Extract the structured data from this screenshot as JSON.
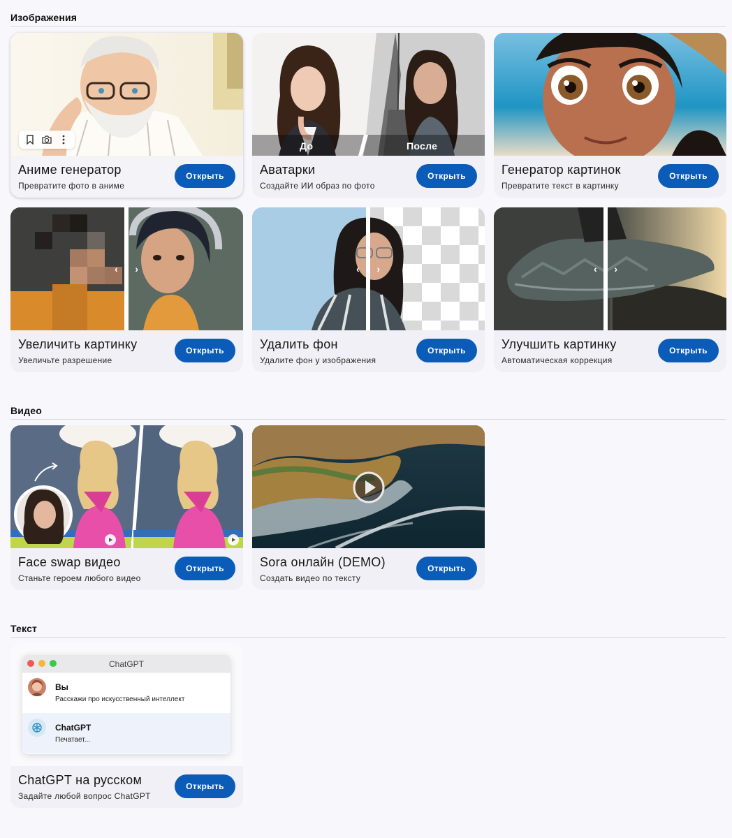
{
  "sections": {
    "images": "Изображения",
    "video": "Видео",
    "text": "Текст"
  },
  "open_label": "Открыть",
  "cards": {
    "anime": {
      "title": "Аниме генератор",
      "sub": "Превратите фото в аниме"
    },
    "avatars": {
      "title": "Аватарки",
      "sub": "Создайте ИИ образ по фото",
      "before": "До",
      "after": "После"
    },
    "generator": {
      "title": "Генератор картинок",
      "sub": "Превратите текст в картинку"
    },
    "upscale": {
      "title": "Увеличить картинку",
      "sub": "Увеличьте разрешение"
    },
    "removebg": {
      "title": "Удалить фон",
      "sub": "Удалите фон у изображения"
    },
    "enhance": {
      "title": "Улучшить картинку",
      "sub": "Автоматическая коррекция"
    },
    "faceswap": {
      "title": "Face swap видео",
      "sub": "Станьте героем любого видео"
    },
    "sora": {
      "title": "Sora онлайн (DEMO)",
      "sub": "Создать видео по тексту"
    },
    "chatgpt": {
      "title": "ChatGPT на русском",
      "sub": "Задайте любой вопрос ChatGPT"
    }
  },
  "chat_preview": {
    "window_title": "ChatGPT",
    "user_name": "Вы",
    "user_message": "Расскажи про искусственный интеллект",
    "bot_name": "ChatGPT",
    "bot_message": "Печатает..."
  },
  "colors": {
    "accent": "#0b5cb8",
    "page_bg": "#f7f7fc",
    "card_bg": "#f0f0f6"
  },
  "icons": {
    "toolbar": [
      "bookmark-icon",
      "camera-icon",
      "more-vertical-icon"
    ],
    "slider": [
      "chevron-left-icon",
      "chevron-right-icon"
    ],
    "video": [
      "play-icon"
    ]
  }
}
